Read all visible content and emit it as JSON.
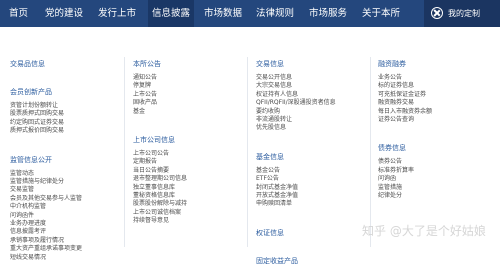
{
  "nav": {
    "items": [
      "首页",
      "党的建设",
      "发行上市",
      "信息披露",
      "市场数据",
      "法律规则",
      "市场服务",
      "关于本所"
    ],
    "active": "信息披露",
    "custom_label": "我的定制"
  },
  "columns": [
    {
      "sections": [
        {
          "title": "交易品信息",
          "items": []
        },
        {
          "title": "会员创新产品",
          "items": [
            "资管计划份额转让",
            "股票质押式回购交易",
            "约定购回式证券交易",
            "质押式报价回购交易"
          ]
        },
        {
          "title": "监管信息公开",
          "items": [
            "监管动态",
            "监管措施与纪律处分",
            "交易监管",
            "会员及其他交易参与人监管",
            "中介机构监管",
            "问询函件",
            "业务办理进度",
            "信息披露考评",
            "承销事项及履行情况",
            "重大资产重组承诺事项变更",
            "短线交易情况"
          ]
        }
      ]
    },
    {
      "sections": [
        {
          "title": "本所公告",
          "items": [
            "通知公告",
            "停复牌",
            "上市公告",
            "固收产品",
            "基金"
          ]
        },
        {
          "title": "上市公司信息",
          "items": [
            "上市公司公告",
            "定期报告",
            "当日公告摘要",
            "退市整理期公司信息",
            "独立董事信息库",
            "董秘资格信息库",
            "股票股份解除与减持",
            "上市公司诚信档案",
            "持续督导意见"
          ]
        }
      ]
    },
    {
      "sections": [
        {
          "title": "交易信息",
          "items": [
            "交易公开信息",
            "大宗交易信息",
            "权证持有人信息",
            "QFII/RQFII/深股通投资者信息",
            "要约收购",
            "非流通股转让",
            "优先股信息"
          ]
        },
        {
          "title": "基金信息",
          "items": [
            "基金公告",
            "ETF公告",
            "封闭式基金净值",
            "开放式基金净值",
            "申购赎回清单"
          ]
        },
        {
          "title": "权证信息",
          "items": []
        },
        {
          "title": "固定收益产品",
          "items": []
        }
      ]
    },
    {
      "sections": [
        {
          "title": "融资融券",
          "items": [
            "业务公告",
            "标的证券信息",
            "可充抵保证金证券",
            "融资融券交易",
            "每日入市融资券余额",
            "证券公告查询"
          ]
        },
        {
          "title": "债券信息",
          "items": [
            "债券公告",
            "标准券折算率",
            "问询函",
            "监管措施",
            "纪律处分"
          ]
        }
      ]
    }
  ],
  "watermark": "知乎 @大了是个好姑娘"
}
